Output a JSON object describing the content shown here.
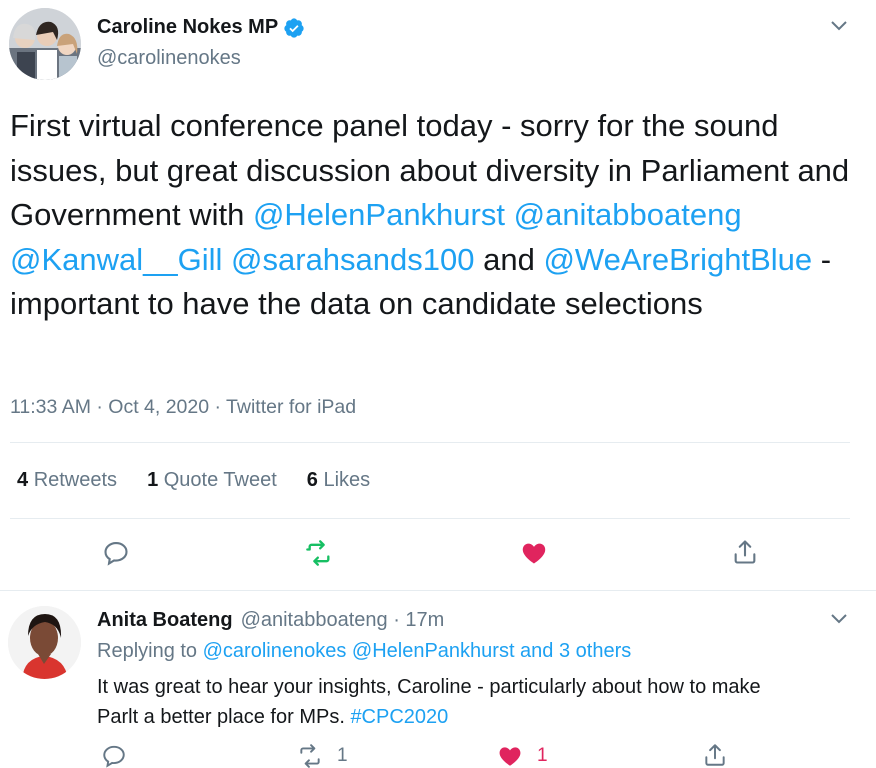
{
  "tweet": {
    "display_name": "Caroline Nokes MP",
    "handle": "@carolinenokes",
    "text_parts": [
      {
        "t": "First virtual conference panel today - sorry for the sound issues, but great discussion about diversity in Parliament and Government with "
      },
      {
        "t": "@HelenPankhurst"
      },
      {
        "t": " "
      },
      {
        "t": "@anitabboateng"
      },
      {
        "t": " "
      },
      {
        "t": "@Kanwal__Gill"
      },
      {
        "t": " "
      },
      {
        "t": "@sarahsands100"
      },
      {
        "t": " and "
      },
      {
        "t": "@WeAreBrightBlue"
      },
      {
        "t": " - important to have the data on candidate selections"
      }
    ],
    "meta": "11:33 AM · Oct 4, 2020 · Twitter for iPad",
    "stats": {
      "retweets_count": "4",
      "retweets_label": "Retweets",
      "quotes_count": "1",
      "quotes_label": "Quote Tweet",
      "likes_count": "6",
      "likes_label": "Likes"
    }
  },
  "reply": {
    "display_name": "Anita Boateng",
    "handle_time": "@anitabboateng · 17m",
    "replying_prefix": "Replying to ",
    "replying_targets": "@carolinenokes @HelenPankhurst and 3 others",
    "text_line1": "It was great to hear your insights, Caroline - particularly about how to make",
    "text_line2_plain": "Parlt a better place for MPs. ",
    "hashtag": "#CPC2020",
    "retweet_count": "1",
    "like_count": "1"
  },
  "colors": {
    "accent": "#1da1f2",
    "retweet_green": "#17bf63",
    "like_red": "#e0245e",
    "muted": "#657786",
    "text": "#14171a"
  },
  "icons": [
    "verified-badge-icon",
    "chevron-down-icon",
    "reply-icon",
    "retweet-icon",
    "heart-icon",
    "share-icon"
  ]
}
